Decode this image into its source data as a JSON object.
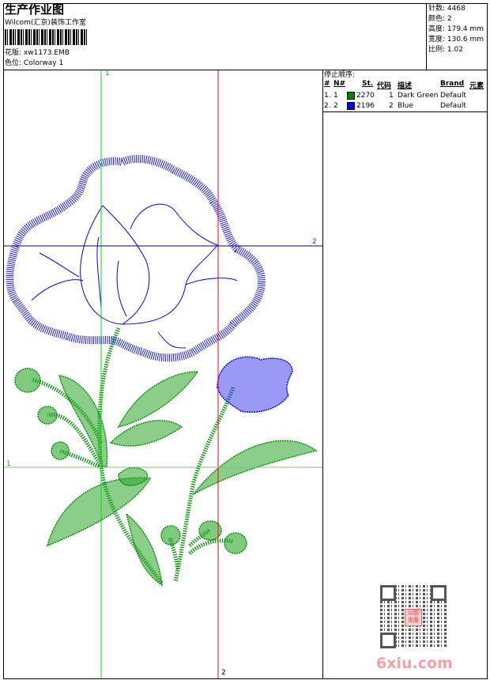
{
  "header": {
    "title": "生产作业图",
    "company": "Wilcom(汇京)装饰工作室",
    "design_label": "花版:",
    "design_value": "xw1173.EMB",
    "colorway_label": "色位:",
    "colorway_value": "Colorway 1"
  },
  "stats": {
    "stitches": "针数: 4468",
    "colors": "颜色: 2",
    "height": "高度: 179.4 mm",
    "width": "宽度: 130.6 mm",
    "scale": "比例: 1.02"
  },
  "stop_sequence": {
    "title": "停止顺序:",
    "columns": [
      "#",
      "N#",
      "St.",
      "代码",
      "描述",
      "Brand",
      "元素"
    ],
    "rows": [
      {
        "idx": "1.",
        "n": "1",
        "color": "#008000",
        "st": "2270",
        "code": "1",
        "desc": "Dark Green",
        "brand": "Default"
      },
      {
        "idx": "2.",
        "n": "2",
        "color": "#0000ff",
        "st": "2196",
        "code": "2",
        "desc": "Blue",
        "brand": "Default"
      }
    ]
  },
  "guides": {
    "green_v_label": "1",
    "green_h_label": "1",
    "red_v_label": "2",
    "red_h_label": "2"
  },
  "watermark": {
    "text": "6xiu.com",
    "seal": "以图出版"
  }
}
